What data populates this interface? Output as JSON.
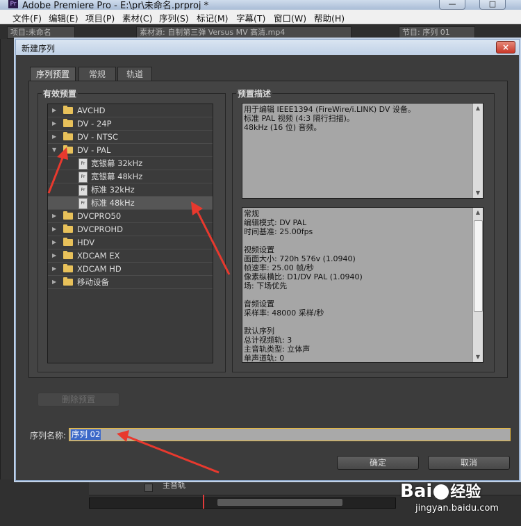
{
  "app": {
    "title": "Adobe Premiere Pro - E:\\pr\\未命名.prproj *",
    "icon": "Pr"
  },
  "window_controls": {
    "minimize": "—",
    "maximize": "□"
  },
  "menubar": [
    "文件(F)",
    "编辑(E)",
    "项目(P)",
    "素材(C)",
    "序列(S)",
    "标记(M)",
    "字幕(T)",
    "窗口(W)",
    "帮助(H)"
  ],
  "background_tabs": {
    "project": "项目:未命名",
    "source": "素材源: 自制第三弹 Versus MV 高清.mp4",
    "program": "节目: 序列 01",
    "master_track": "主音轨"
  },
  "dialog": {
    "title": "新建序列",
    "close": "×",
    "tabs": [
      {
        "label": "序列预置",
        "active": true
      },
      {
        "label": "常规",
        "active": false
      },
      {
        "label": "轨道",
        "active": false
      }
    ],
    "presets": {
      "title": "有效预置",
      "items": [
        {
          "label": "AVCHD",
          "type": "folder",
          "expanded": false
        },
        {
          "label": "DV - 24P",
          "type": "folder",
          "expanded": false
        },
        {
          "label": "DV - NTSC",
          "type": "folder",
          "expanded": false
        },
        {
          "label": "DV - PAL",
          "type": "folder",
          "expanded": true
        },
        {
          "label": "宽银幕 32kHz",
          "type": "file",
          "selected": false
        },
        {
          "label": "宽银幕 48kHz",
          "type": "file",
          "selected": false
        },
        {
          "label": "标准 32kHz",
          "type": "file",
          "selected": false
        },
        {
          "label": "标准 48kHz",
          "type": "file",
          "selected": true
        },
        {
          "label": "DVCPRO50",
          "type": "folder",
          "expanded": false
        },
        {
          "label": "DVCPROHD",
          "type": "folder",
          "expanded": false
        },
        {
          "label": "HDV",
          "type": "folder",
          "expanded": false
        },
        {
          "label": "XDCAM EX",
          "type": "folder",
          "expanded": false
        },
        {
          "label": "XDCAM HD",
          "type": "folder",
          "expanded": false
        },
        {
          "label": "移动设备",
          "type": "folder",
          "expanded": false
        }
      ]
    },
    "description": {
      "title": "预置描述",
      "lines": [
        "用于编辑 IEEE1394 (FireWire/i.LINK) DV 设备。",
        "标准 PAL 视频 (4:3 隔行扫描)。",
        "48kHz (16 位) 音频。"
      ]
    },
    "details": {
      "lines": [
        "常规",
        " 编辑模式: DV PAL",
        " 时间基准: 25.00fps",
        "",
        "视频设置",
        " 画面大小: 720h 576v (1.0940)",
        " 帧速率: 25.00 帧/秒",
        " 像素纵横比: D1/DV PAL (1.0940)",
        " 场: 下场优先",
        "",
        "音频设置",
        " 采样率: 48000 采样/秒",
        "",
        "默认序列",
        " 总计视频轨: 3",
        " 主音轨类型: 立体声",
        " 单声道轨: 0"
      ]
    },
    "delete_preset_label": "删除预置",
    "sequence_name_label": "序列名称:",
    "sequence_name_value": "序列 02",
    "ok_label": "确定",
    "cancel_label": "取消"
  },
  "watermark": {
    "brand": "Bai",
    "brand2": "经验",
    "site": "jingyan.baidu.com"
  },
  "colors": {
    "accent_selection": "#3b68c8",
    "annotation_arrow": "#e8392e",
    "folder": "#e8c15a"
  }
}
